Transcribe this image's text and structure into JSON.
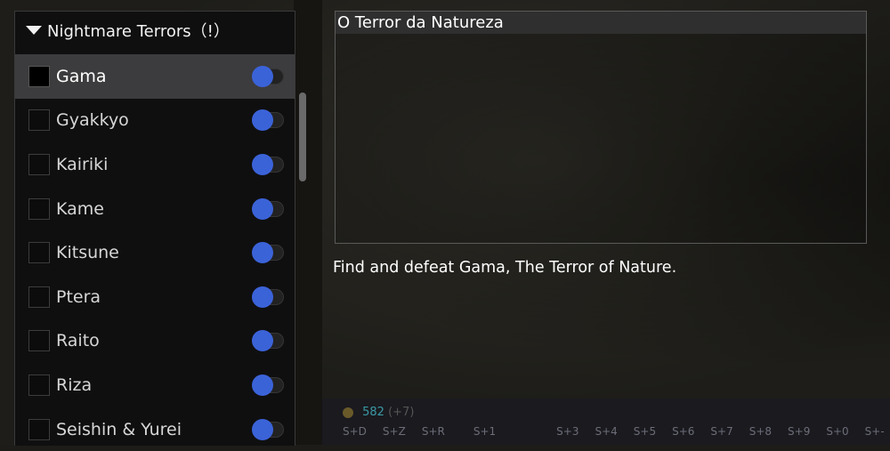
{
  "panel": {
    "title": "Nightmare Terrors（!）",
    "items": [
      {
        "label": "Gama",
        "selected": true,
        "toggle_on": true
      },
      {
        "label": "Gyakkyo",
        "selected": false,
        "toggle_on": true
      },
      {
        "label": "Kairiki",
        "selected": false,
        "toggle_on": true
      },
      {
        "label": "Kame",
        "selected": false,
        "toggle_on": true
      },
      {
        "label": "Kitsune",
        "selected": false,
        "toggle_on": true
      },
      {
        "label": "Ptera",
        "selected": false,
        "toggle_on": true
      },
      {
        "label": "Raito",
        "selected": false,
        "toggle_on": true
      },
      {
        "label": "Riza",
        "selected": false,
        "toggle_on": true
      },
      {
        "label": "Seishin & Yurei",
        "selected": false,
        "toggle_on": true
      }
    ]
  },
  "quest": {
    "title": "O Terror da Natureza",
    "description": "Find and defeat Gama, The Terror of Nature."
  },
  "game_hud": {
    "stat_value": "582",
    "stat_delta": "(+7)",
    "hotkeys": [
      "S+D",
      "S+Z",
      "S+R",
      "S+1",
      "S+3",
      "S+4",
      "S+5",
      "S+6",
      "S+7",
      "S+8",
      "S+9",
      "S+0",
      "S+-"
    ]
  },
  "colors": {
    "accent": "#3b63d8",
    "selected_row": "#3c3c3e"
  }
}
